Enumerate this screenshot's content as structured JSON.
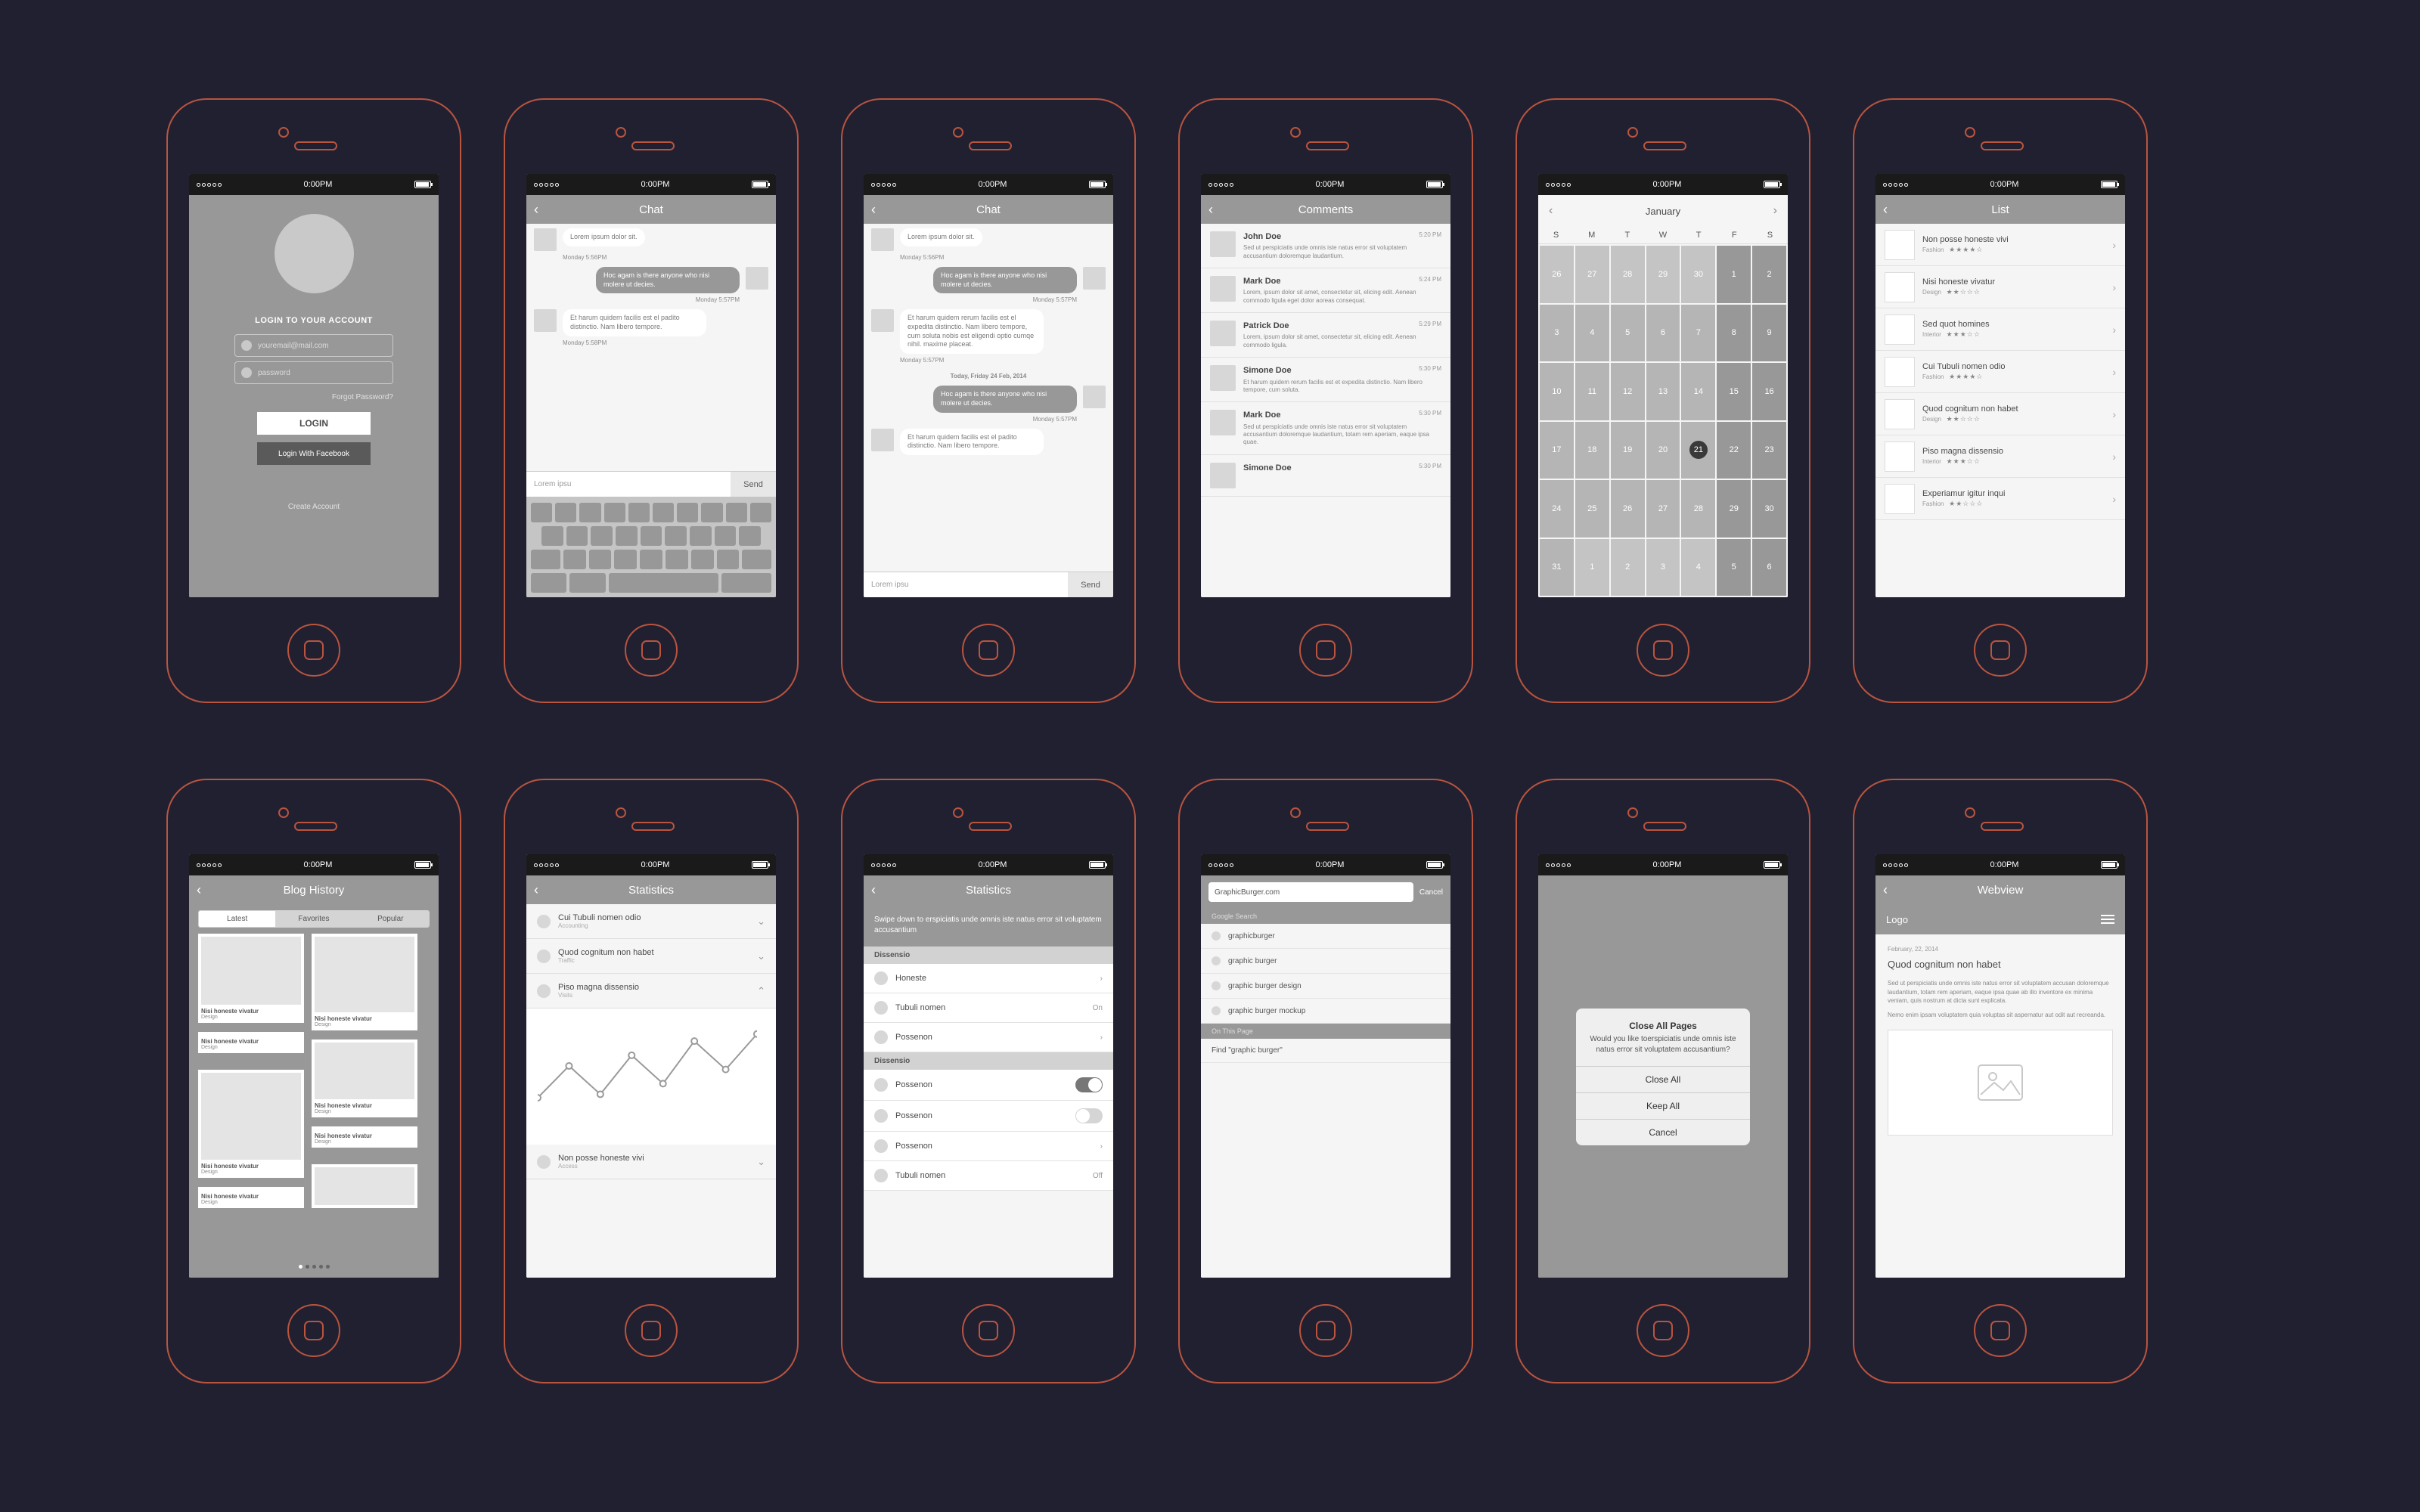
{
  "status_bar": {
    "time": "0:00PM"
  },
  "screens": {
    "login": {
      "heading": "LOGIN TO YOUR ACCOUNT",
      "email_placeholder": "youremail@mail.com",
      "password_placeholder": "password",
      "forgot": "Forgot Password?",
      "login_btn": "LOGIN",
      "facebook_btn": "Login With Facebook",
      "create": "Create Account"
    },
    "chat1": {
      "title": "Chat",
      "messages": [
        {
          "side": "them",
          "text": "Lorem ipsum dolor sit.",
          "stamp": "Monday 5:56PM"
        },
        {
          "side": "me",
          "text": "Hoc agam is there anyone who nisi molere ut decies.",
          "stamp": "Monday 5:57PM"
        },
        {
          "side": "them",
          "text": "Et harum quidem facilis est el padito distinctio. Nam libero tempore.",
          "stamp": "Monday 5:58PM"
        }
      ],
      "input_placeholder": "Lorem ipsu",
      "send": "Send"
    },
    "chat2": {
      "title": "Chat",
      "date_divider": "Today, Friday 24 Feb, 2014",
      "messages_top": [
        {
          "side": "them",
          "text": "Lorem ipsum dolor sit.",
          "stamp": "Monday 5:56PM"
        },
        {
          "side": "me",
          "text": "Hoc agam is there anyone who nisi molere ut decies.",
          "stamp": "Monday 5:57PM"
        },
        {
          "side": "them",
          "text": "Et harum quidem rerum facilis est el expedita distinctio. Nam libero tempore, cum soluta nobis est eligendi optio cumqe nihil. maxime placeat.",
          "stamp": "Monday 5:57PM"
        }
      ],
      "messages_bottom": [
        {
          "side": "me",
          "text": "Hoc agam is there anyone who nisi molere ut decies.",
          "stamp": "Monday 5:57PM"
        },
        {
          "side": "them",
          "text": "Et harum quidem facilis est el padito distinctio. Nam libero tempore.",
          "stamp": ""
        }
      ],
      "input_placeholder": "Lorem ipsu",
      "send": "Send"
    },
    "comments": {
      "title": "Comments",
      "items": [
        {
          "name": "John Doe",
          "time": "5:20 PM",
          "text": "Sed ut perspiciatis unde omnis iste natus error sit voluptatem accusantium doloremque laudantium."
        },
        {
          "name": "Mark Doe",
          "time": "5:24 PM",
          "text": "Lorem, ipsum dolor sit amet, consectetur sit, elicing edit. Aenean commodo ligula eget dolor aoreas consequat."
        },
        {
          "name": "Patrick Doe",
          "time": "5:29 PM",
          "text": "Lorem, ipsum dolor sit amet, consectetur sit, elicing edit. Aenean commodo ligula."
        },
        {
          "name": "Simone Doe",
          "time": "5:30 PM",
          "text": "Et harum quidem rerum facilis est et expedita distinctio. Nam libero tempore, cum soluta."
        },
        {
          "name": "Mark Doe",
          "time": "5:30 PM",
          "text": "Sed ut perspiciatis unde omnis iste natus error sit voluptatem accusantium doloremque laudantium, totam rem aperiam, eaque ipsa quae."
        },
        {
          "name": "Simone Doe",
          "time": "5:30 PM",
          "text": ""
        }
      ]
    },
    "calendar": {
      "month": "January",
      "dow": [
        "S",
        "M",
        "T",
        "W",
        "T",
        "F",
        "S"
      ],
      "selected_day": 21,
      "weeks": [
        [
          {
            "n": 26,
            "dim": true
          },
          {
            "n": 27,
            "dim": true
          },
          {
            "n": 28,
            "dim": true
          },
          {
            "n": 29,
            "dim": true
          },
          {
            "n": 30,
            "dim": true
          },
          {
            "n": 1,
            "dark": true
          },
          {
            "n": 2,
            "dark": true
          }
        ],
        [
          {
            "n": 3
          },
          {
            "n": 4
          },
          {
            "n": 5
          },
          {
            "n": 6
          },
          {
            "n": 7
          },
          {
            "n": 8,
            "dark": true
          },
          {
            "n": 9,
            "dark": true
          }
        ],
        [
          {
            "n": 10
          },
          {
            "n": 11
          },
          {
            "n": 12
          },
          {
            "n": 13
          },
          {
            "n": 14
          },
          {
            "n": 15,
            "dark": true
          },
          {
            "n": 16,
            "dark": true
          }
        ],
        [
          {
            "n": 17
          },
          {
            "n": 18
          },
          {
            "n": 19
          },
          {
            "n": 20
          },
          {
            "n": 21,
            "sel": true
          },
          {
            "n": 22,
            "dark": true
          },
          {
            "n": 23,
            "dark": true
          }
        ],
        [
          {
            "n": 24
          },
          {
            "n": 25
          },
          {
            "n": 26
          },
          {
            "n": 27
          },
          {
            "n": 28
          },
          {
            "n": 29,
            "dark": true
          },
          {
            "n": 30,
            "dark": true
          }
        ],
        [
          {
            "n": 31
          },
          {
            "n": 1,
            "dim": true
          },
          {
            "n": 2,
            "dim": true
          },
          {
            "n": 3,
            "dim": true
          },
          {
            "n": 4,
            "dim": true
          },
          {
            "n": 5,
            "dim": true,
            "dark": true
          },
          {
            "n": 6,
            "dim": true,
            "dark": true
          }
        ]
      ]
    },
    "list": {
      "title": "List",
      "items": [
        {
          "title": "Non posse honeste vivi",
          "sub": "Fashion",
          "rating": 4
        },
        {
          "title": "Nisi honeste vivatur",
          "sub": "Design",
          "rating": 2
        },
        {
          "title": "Sed quot homines",
          "sub": "Interior",
          "rating": 3
        },
        {
          "title": "Cui Tubuli nomen odio",
          "sub": "Fashion",
          "rating": 4
        },
        {
          "title": "Quod cognitum non habet",
          "sub": "Design",
          "rating": 2
        },
        {
          "title": "Piso magna dissensio",
          "sub": "Interior",
          "rating": 3
        },
        {
          "title": "Experiamur igitur inqui",
          "sub": "Fashion",
          "rating": 2
        }
      ]
    },
    "blog": {
      "title": "Blog History",
      "tabs": [
        "Latest",
        "Favorites",
        "Popular"
      ],
      "active_tab": 0,
      "card_title": "Nisi honeste vivatur",
      "card_sub": "Design"
    },
    "stats1": {
      "title": "Statistics",
      "items": [
        {
          "title": "Cui Tubuli nomen odio",
          "sub": "Accounting",
          "state": "down"
        },
        {
          "title": "Quod cognitum non habet",
          "sub": "Traffic",
          "state": "down"
        },
        {
          "title": "Piso magna dissensio",
          "sub": "Visits",
          "state": "up"
        },
        {
          "title": "Non posse honeste vivi",
          "sub": "Access",
          "state": "down"
        }
      ]
    },
    "stats2": {
      "title": "Statistics",
      "intro": "Swipe down to erspiciatis unde omnis iste natus error sit voluptatem accusantium",
      "section1": "Dissensio",
      "rows1": [
        {
          "label": "Honeste",
          "type": "chev"
        },
        {
          "label": "Tubuli nomen",
          "type": "value",
          "value": "On"
        },
        {
          "label": "Possenon",
          "type": "chev"
        }
      ],
      "section2": "Dissensio",
      "rows2": [
        {
          "label": "Possenon",
          "type": "toggle",
          "on": true
        },
        {
          "label": "Possenon",
          "type": "toggle",
          "on": false
        },
        {
          "label": "Possenon",
          "type": "chev"
        },
        {
          "label": "Tubuli nomen",
          "type": "value",
          "value": "Off"
        }
      ]
    },
    "search": {
      "input": "GraphicBurger.com",
      "cancel": "Cancel",
      "header1": "Google Search",
      "suggestions": [
        "graphicburger",
        "graphic burger",
        "graphic burger design",
        "graphic burger mockup"
      ],
      "header2": "On This Page",
      "find": "Find \"graphic burger\""
    },
    "alert": {
      "title": "Close All Pages",
      "message": "Would you like toerspiciatis unde omnis iste natus error sit voluptatem accusantium?",
      "buttons": [
        "Close All",
        "Keep All",
        "Cancel"
      ]
    },
    "webview": {
      "header": "Webview",
      "logo": "Logo",
      "date": "February, 22, 2014",
      "title": "Quod cognitum non habet",
      "p1": "Sed ut perspiciatis unde omnis iste natus error sit voluptatem accusan doloremque laudantium, totam rem aperiam, eaque ipsa quae ab illo inventore ex minima veniam, quis nostrum at dicta sunt explicata.",
      "p2": "Nemo enim ipsam voluptatem quia voluptas sit aspernatur aut odit aut recreanda."
    }
  },
  "chart_data": {
    "type": "line",
    "title": "",
    "x": [
      0,
      1,
      2,
      3,
      4,
      5,
      6,
      7
    ],
    "values": [
      50,
      95,
      55,
      110,
      70,
      130,
      90,
      140
    ],
    "ylim": [
      0,
      160
    ]
  }
}
